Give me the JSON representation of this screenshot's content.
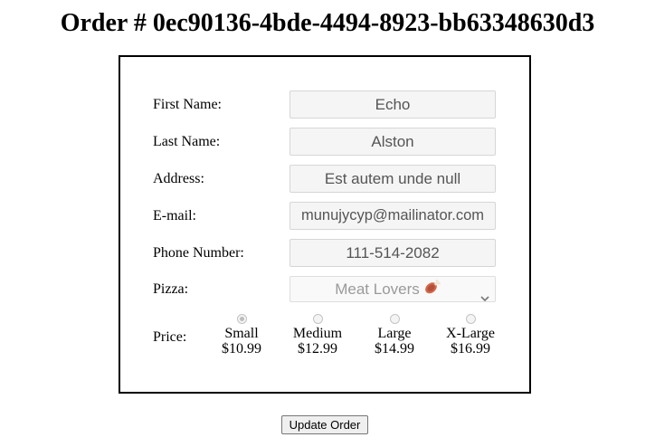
{
  "order": {
    "title": "Order # 0ec90136-4bde-4494-8923-bb63348630d3"
  },
  "form": {
    "first_name": {
      "label": "First Name:",
      "value": "Echo"
    },
    "last_name": {
      "label": "Last Name:",
      "value": "Alston"
    },
    "address": {
      "label": "Address:",
      "value": "Est autem unde null"
    },
    "email": {
      "label": "E-mail:",
      "value": "munujycyp@mailinator.com"
    },
    "phone": {
      "label": "Phone Number:",
      "value": "111-514-2082"
    },
    "pizza": {
      "label": "Pizza:",
      "value": "Meat Lovers",
      "emoji": "🍖",
      "icon": "chevron-down-icon"
    },
    "price": {
      "label": "Price:",
      "selected": "Small",
      "options": [
        {
          "name": "Small",
          "price": "$10.99"
        },
        {
          "name": "Medium",
          "price": "$12.99"
        },
        {
          "name": "Large",
          "price": "$14.99"
        },
        {
          "name": "X-Large",
          "price": "$16.99"
        }
      ]
    }
  },
  "actions": {
    "update_label": "Update Order"
  }
}
